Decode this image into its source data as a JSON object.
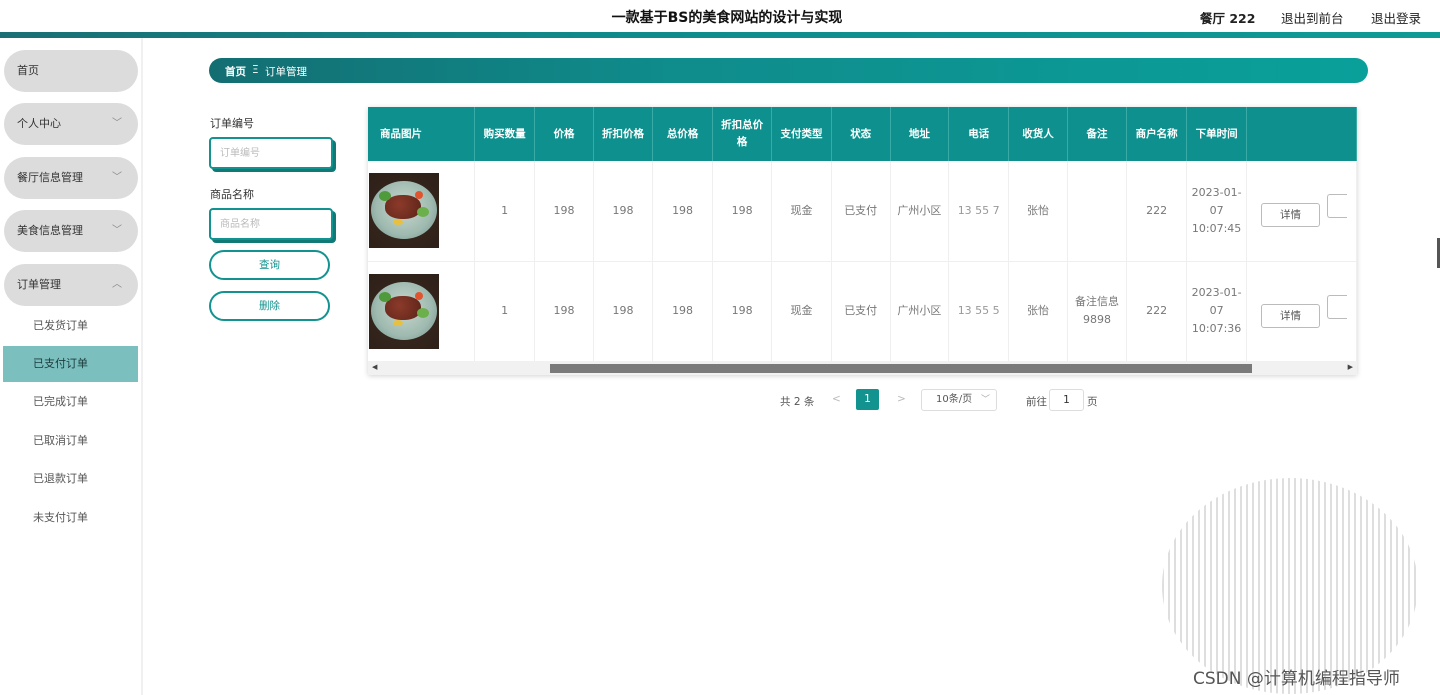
{
  "header": {
    "title": "一款基于BS的美食网站的设计与实现",
    "user": "餐厅 222",
    "front_link": "退出到前台",
    "logout_link": "退出登录"
  },
  "sidebar": {
    "items": [
      {
        "label": "首页"
      },
      {
        "label": "个人中心",
        "chevron": "﹀"
      },
      {
        "label": "餐厅信息管理",
        "chevron": "﹀"
      },
      {
        "label": "美食信息管理",
        "chevron": "﹀"
      },
      {
        "label": "订单管理",
        "chevron": "︿"
      }
    ],
    "sub_items": [
      {
        "label": "已发货订单"
      },
      {
        "label": "已支付订单",
        "active": true
      },
      {
        "label": "已完成订单"
      },
      {
        "label": "已取消订单"
      },
      {
        "label": "已退款订单"
      },
      {
        "label": "未支付订单"
      }
    ]
  },
  "breadcrumb": {
    "home": "首页",
    "separator": "Ξ",
    "current": "订单管理"
  },
  "search": {
    "order_no_label": "订单编号",
    "order_no_placeholder": "订单编号",
    "product_label": "商品名称",
    "product_placeholder": "商品名称",
    "query_button": "查询",
    "delete_button": "删除"
  },
  "table": {
    "columns": [
      "商品图片",
      "购买数量",
      "价格",
      "折扣价格",
      "总价格",
      "折扣总价格",
      "支付类型",
      "状态",
      "地址",
      "电话",
      "收货人",
      "备注",
      "商户名称",
      "下单时间"
    ],
    "rows": [
      {
        "qty": "1",
        "price": "198",
        "discount_price": "198",
        "total": "198",
        "discount_total": "198",
        "pay_type": "现金",
        "status": "已支付",
        "address": "广州小区",
        "phone": "13 55 7",
        "receiver": "张怡",
        "remark": "",
        "merchant": "222",
        "time": "2023-01-07 10:07:45"
      },
      {
        "qty": "1",
        "price": "198",
        "discount_price": "198",
        "total": "198",
        "discount_total": "198",
        "pay_type": "现金",
        "status": "已支付",
        "address": "广州小区",
        "phone": "13 55 5",
        "receiver": "张怡",
        "remark": "备注信息9898",
        "merchant": "222",
        "time": "2023-01-07 10:07:36"
      }
    ],
    "detail_button": "详情"
  },
  "pagination": {
    "total": "共 2 条",
    "prev": "<",
    "current_page": "1",
    "next": ">",
    "page_size": "10条/页",
    "goto_label": "前往",
    "goto_value": "1",
    "page_unit": "页"
  },
  "watermark": "CSDN @计算机编程指导师"
}
